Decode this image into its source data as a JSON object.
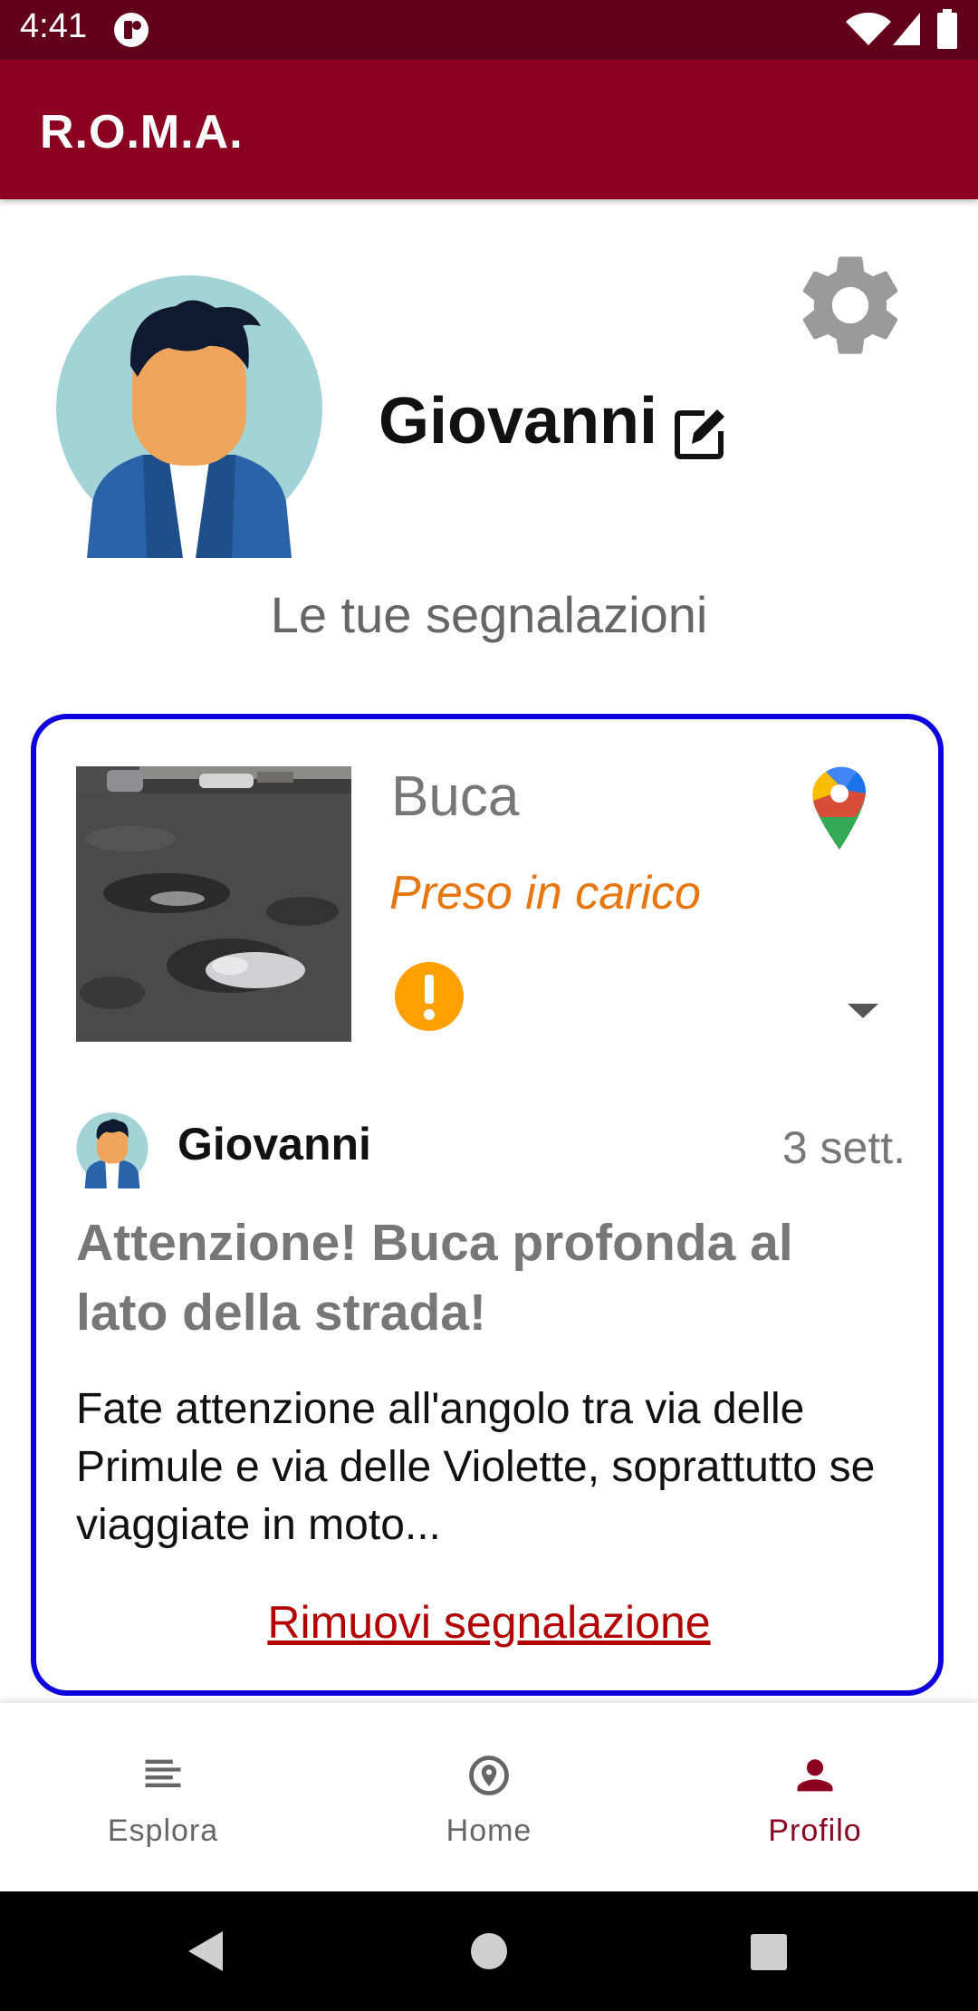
{
  "status_bar": {
    "time": "4:41"
  },
  "app_bar": {
    "title": "R.O.M.A."
  },
  "profile": {
    "name": "Giovanni",
    "section_title": "Le tue segnalazioni"
  },
  "report": {
    "category": "Buca",
    "status": "Preso in carico",
    "status_color": "#e8760e",
    "author": "Giovanni",
    "age": "3 sett.",
    "title": "Attenzione! Buca profonda al lato della strada!",
    "body": "Fate attenzione all'angolo tra via delle Primule e via delle Violette, soprattutto se viaggiate in moto...",
    "remove_label": "Rimuovi segnalazione"
  },
  "bottom_nav": {
    "items": [
      {
        "label": "Esplora",
        "icon": "list-icon"
      },
      {
        "label": "Home",
        "icon": "location-icon"
      },
      {
        "label": "Profilo",
        "icon": "person-icon",
        "active": true
      }
    ],
    "active_color": "#8b0020"
  },
  "colors": {
    "brand": "#8b0020",
    "status_bar": "#62001b",
    "card_border": "#0e00dc",
    "remove_link": "#b30000"
  }
}
